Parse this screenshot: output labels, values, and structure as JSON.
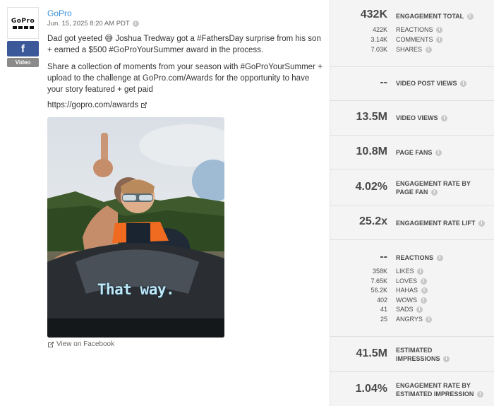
{
  "post": {
    "author": "GoPro",
    "logo_text": "GoPro",
    "network_badge": "f",
    "type_badge": "Video",
    "timestamp": "Jun. 15, 2025 8:20 AM PDT",
    "message_p1": "Dad got yeeted 😅 Joshua Tredway got a #FathersDay surprise from his son + earned a $500 #GoProYourSummer award in the process.",
    "message_p2": "Share a collection of moments from your season with #GoProYourSummer + upload to the challenge at GoPro.com/Awards for the opportunity to have your story featured + get paid",
    "link": "https://gopro.com/awards",
    "video_caption": "That way.",
    "view_on": "View on Facebook"
  },
  "stats": {
    "engagement_total": {
      "value": "432K",
      "label": "Engagement Total"
    },
    "reactions_line": {
      "value": "422K",
      "label": "Reactions"
    },
    "comments_line": {
      "value": "3.14K",
      "label": "Comments"
    },
    "shares_line": {
      "value": "7.03K",
      "label": "Shares"
    },
    "video_post_views": {
      "value": "--",
      "label": "Video Post Views"
    },
    "video_views": {
      "value": "13.5M",
      "label": "Video Views"
    },
    "page_fans": {
      "value": "10.8M",
      "label": "Page Fans"
    },
    "eng_rate_fan": {
      "value": "4.02%",
      "label_line1": "Engagement Rate by",
      "label_line2": "Page Fan"
    },
    "eng_rate_lift": {
      "value": "25.2x",
      "label": "Engagement Rate Lift"
    },
    "reactions": {
      "value": "--",
      "label": "Reactions"
    },
    "likes": {
      "value": "358K",
      "label": "Likes"
    },
    "loves": {
      "value": "7.65K",
      "label": "Loves"
    },
    "hahas": {
      "value": "56.2K",
      "label": "Hahas"
    },
    "wows": {
      "value": "402",
      "label": "Wows"
    },
    "sads": {
      "value": "41",
      "label": "Sads"
    },
    "angrys": {
      "value": "25",
      "label": "Angrys"
    },
    "est_impressions": {
      "value": "41.5M",
      "label_line1": "Estimated",
      "label_line2": "Impressions"
    },
    "eng_rate_impression": {
      "value": "1.04%",
      "label_line1": "Engagement Rate by",
      "label_line2": "Estimated Impression"
    }
  },
  "colors": {
    "link_blue": "#3a8fd8",
    "facebook_blue": "#3b5998",
    "panel_bg": "#f4f4f4"
  }
}
